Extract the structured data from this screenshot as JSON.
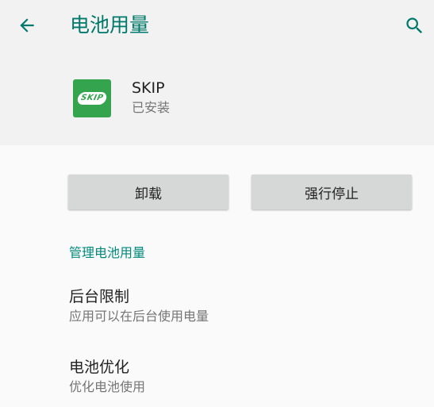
{
  "toolbar": {
    "title": "电池用量",
    "back_icon": "arrow-back-icon",
    "search_icon": "search-icon"
  },
  "app": {
    "name": "SKIP",
    "status": "已安装",
    "icon_text": "SKIP",
    "icon_color": "#35a44f"
  },
  "buttons": {
    "uninstall": "卸载",
    "force_stop": "强行停止"
  },
  "section": {
    "title": "管理电池用量"
  },
  "preferences": [
    {
      "title": "后台限制",
      "summary": "应用可以在后台使用电量"
    },
    {
      "title": "电池优化",
      "summary": "优化电池使用"
    }
  ],
  "colors": {
    "accent": "#00796b",
    "section_accent": "#00897b",
    "button_bg": "#d6d7d7"
  }
}
